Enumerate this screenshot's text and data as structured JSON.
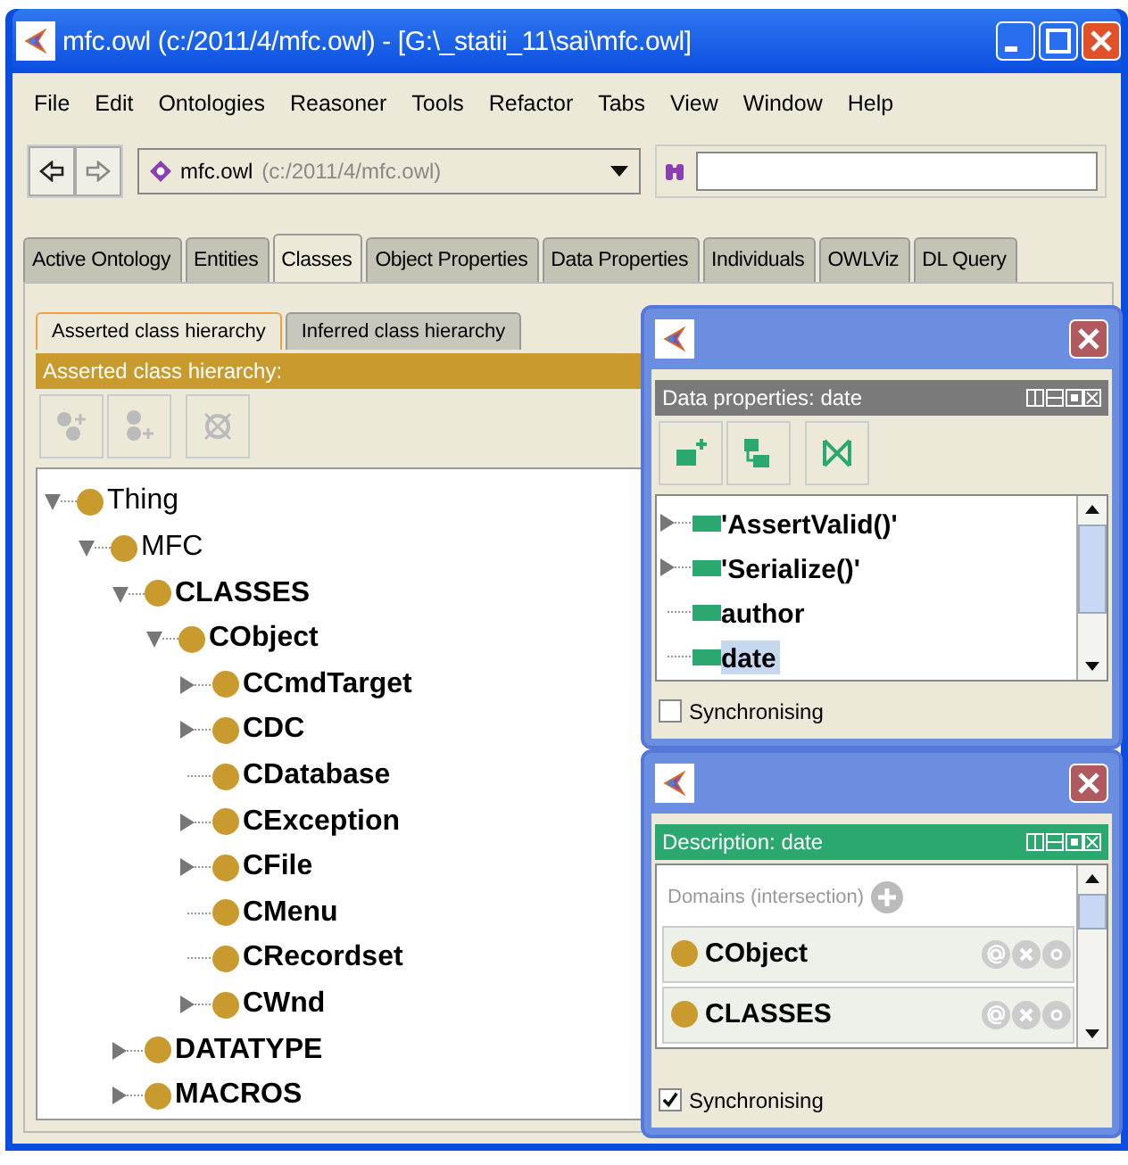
{
  "window": {
    "title": "mfc.owl (c:/2011/4/mfc.owl) - [G:\\_statii_11\\sai\\mfc.owl]"
  },
  "menu": [
    "File",
    "Edit",
    "Ontologies",
    "Reasoner",
    "Tools",
    "Refactor",
    "Tabs",
    "View",
    "Window",
    "Help"
  ],
  "toolbar": {
    "ontology_name": "mfc.owl",
    "ontology_path": "(c:/2011/4/mfc.owl)"
  },
  "tabs": [
    {
      "label": "Active Ontology",
      "selected": false
    },
    {
      "label": "Entities",
      "selected": false
    },
    {
      "label": "Classes",
      "selected": true
    },
    {
      "label": "Object Properties",
      "selected": false
    },
    {
      "label": "Data Properties",
      "selected": false
    },
    {
      "label": "Individuals",
      "selected": false
    },
    {
      "label": "OWLViz",
      "selected": false
    },
    {
      "label": "DL Query",
      "selected": false
    }
  ],
  "subtabs": [
    {
      "label": "Asserted class hierarchy",
      "selected": true
    },
    {
      "label": "Inferred class hierarchy",
      "selected": false
    }
  ],
  "hierarchy": {
    "header": "Asserted class hierarchy:",
    "tree": [
      {
        "label": "Thing",
        "kind": "branch",
        "expanded": true,
        "bold": false,
        "children": [
          {
            "label": "MFC",
            "kind": "branch",
            "expanded": true,
            "bold": false,
            "children": [
              {
                "label": "CLASSES",
                "kind": "branch",
                "expanded": true,
                "bold": true,
                "children": [
                  {
                    "label": "CObject",
                    "kind": "branch",
                    "expanded": true,
                    "bold": true,
                    "children": [
                      {
                        "label": "CCmdTarget",
                        "kind": "branch",
                        "expanded": false,
                        "bold": true
                      },
                      {
                        "label": "CDC",
                        "kind": "branch",
                        "expanded": false,
                        "bold": true
                      },
                      {
                        "label": "CDatabase",
                        "kind": "leaf",
                        "bold": true
                      },
                      {
                        "label": "CException",
                        "kind": "branch",
                        "expanded": false,
                        "bold": true
                      },
                      {
                        "label": "CFile",
                        "kind": "branch",
                        "expanded": false,
                        "bold": true
                      },
                      {
                        "label": "CMenu",
                        "kind": "leaf",
                        "bold": true
                      },
                      {
                        "label": "CRecordset",
                        "kind": "leaf",
                        "bold": true
                      },
                      {
                        "label": "CWnd",
                        "kind": "branch",
                        "expanded": false,
                        "bold": true
                      }
                    ]
                  }
                ]
              },
              {
                "label": "DATATYPE",
                "kind": "branch",
                "expanded": false,
                "bold": true
              },
              {
                "label": "MACROS",
                "kind": "branch",
                "expanded": false,
                "bold": true
              }
            ]
          }
        ]
      }
    ]
  },
  "data_properties_window": {
    "header": "Data properties: date",
    "items": [
      {
        "label": "'AssertValid()'",
        "kind": "branch",
        "expanded": false,
        "selected": false
      },
      {
        "label": "'Serialize()'",
        "kind": "branch",
        "expanded": false,
        "selected": false
      },
      {
        "label": "author",
        "kind": "leaf",
        "selected": false
      },
      {
        "label": "date",
        "kind": "leaf",
        "selected": true
      }
    ],
    "synchronising": {
      "label": "Synchronising",
      "checked": false
    }
  },
  "description_window": {
    "header": "Description: date",
    "section": "Domains (intersection)",
    "domains": [
      "CObject",
      "CLASSES"
    ],
    "synchronising": {
      "label": "Synchronising",
      "checked": true
    }
  }
}
